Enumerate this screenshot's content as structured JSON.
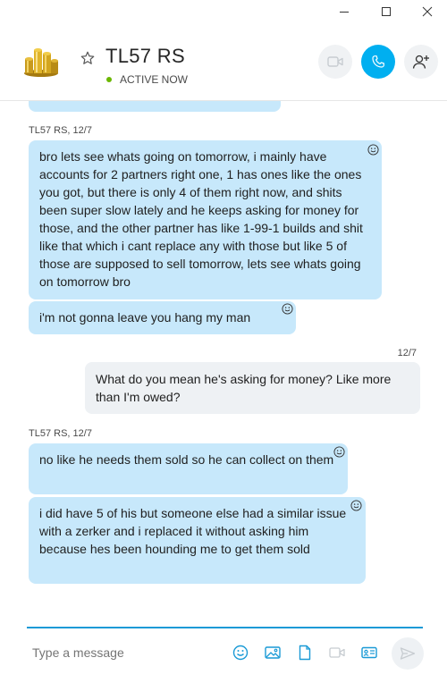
{
  "window": {
    "minimize_icon": "minimize-icon",
    "maximize_icon": "maximize-icon",
    "close_icon": "close-icon"
  },
  "header": {
    "contact_name": "TL57 RS",
    "status": "ACTIVE NOW",
    "status_color": "#6bb700",
    "accent_color": "#00aff0"
  },
  "messages": [
    {
      "sender_line": "TL57 RS, 12/7",
      "bubbles": [
        {
          "text": "bro lets see whats going on tomorrow, i mainly have accounts for 2 partners right one, 1 has ones like the ones you got, but there is only 4 of them right now, and shits been super slow lately and he keeps asking for money for those, and the other partner has like 1-99-1 builds and shit like that which i cant replace any with those but like 5 of those are supposed to sell tomorrow, lets see whats going on tomorrow bro"
        },
        {
          "text": "i'm not gonna leave you hang my man"
        }
      ]
    },
    {
      "outgoing_time": "12/7",
      "bubbles": [
        {
          "text": "What do you mean he's asking for money? Like more than I'm owed?"
        }
      ]
    },
    {
      "sender_line": "TL57 RS, 12/7",
      "bubbles": [
        {
          "text": "no like he needs them sold so he can collect on them"
        },
        {
          "text": "i did have 5 of his but someone else had a similar issue with a zerker and i replaced it without asking him because hes been hounding me to get them sold"
        }
      ]
    }
  ],
  "compose": {
    "placeholder": "Type a message"
  }
}
